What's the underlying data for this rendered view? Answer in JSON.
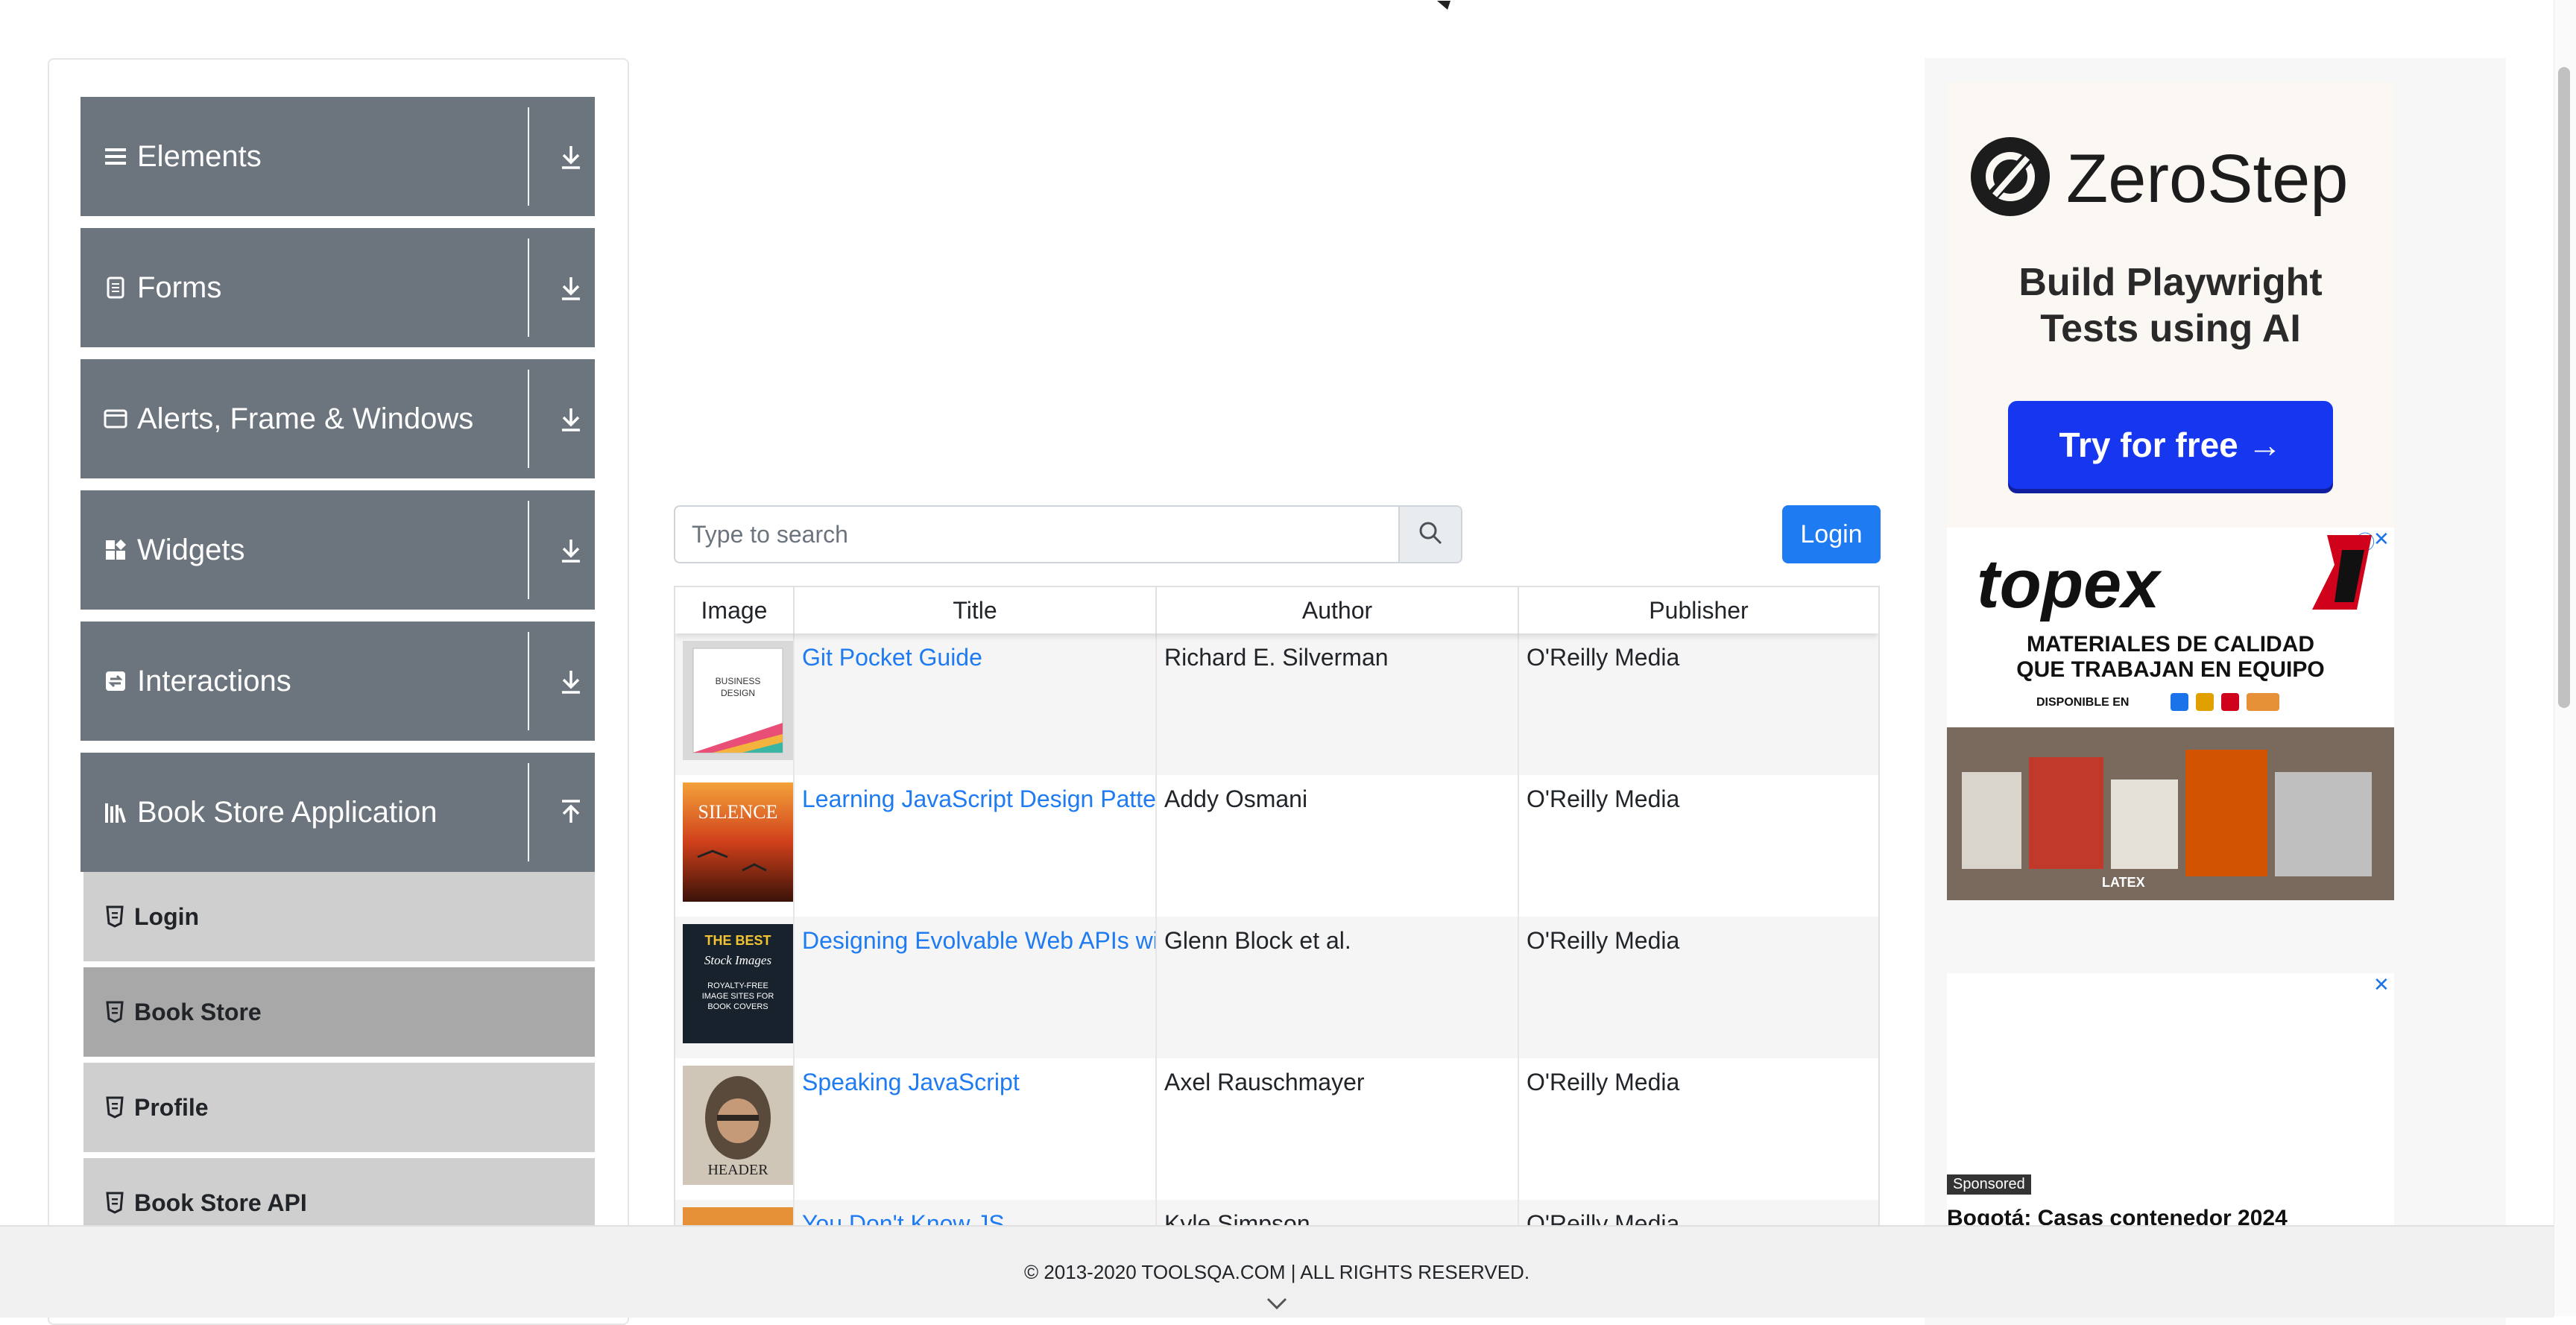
{
  "sidebar": {
    "groups": [
      {
        "label": "Elements",
        "icon": "list-icon"
      },
      {
        "label": "Forms",
        "icon": "document-icon"
      },
      {
        "label": "Alerts, Frame & Windows",
        "icon": "window-icon"
      },
      {
        "label": "Widgets",
        "icon": "widgets-icon"
      },
      {
        "label": "Interactions",
        "icon": "interactions-icon"
      },
      {
        "label": "Book Store Application",
        "icon": "books-icon"
      }
    ],
    "book_store_items": [
      {
        "label": "Login"
      },
      {
        "label": "Book Store"
      },
      {
        "label": "Profile"
      },
      {
        "label": "Book Store API"
      }
    ]
  },
  "search": {
    "placeholder": "Type to search"
  },
  "login_button": "Login",
  "table": {
    "headers": [
      "Image",
      "Title",
      "Author",
      "Publisher"
    ],
    "rows": [
      {
        "title": "Git Pocket Guide",
        "author": "Richard E. Silverman",
        "publisher": "O'Reilly Media",
        "cover_text": [
          "BUSINESS",
          "DESIGN"
        ]
      },
      {
        "title": "Learning JavaScript Design Patte",
        "author": "Addy Osmani",
        "publisher": "O'Reilly Media",
        "cover_text": [
          "SILENCE"
        ]
      },
      {
        "title": "Designing Evolvable Web APIs wi",
        "author": "Glenn Block et al.",
        "publisher": "O'Reilly Media",
        "cover_text": [
          "THE BEST",
          "Stock Images",
          "ROYALTY-FREE",
          "IMAGE SITES FOR",
          "BOOK COVERS"
        ]
      },
      {
        "title": "Speaking JavaScript",
        "author": "Axel Rauschmayer",
        "publisher": "O'Reilly Media",
        "cover_text": [
          "HEADER"
        ]
      },
      {
        "title": "You Don't Know JS",
        "author": "Kyle Simpson",
        "publisher": "O'Reilly Media",
        "cover_text": []
      }
    ]
  },
  "ads": {
    "zerostep": {
      "brand": "ZeroStep",
      "tagline": "Build Playwright Tests using AI",
      "cta": "Try for free →"
    },
    "topex": {
      "brand": "topex",
      "line1": "MATERIALES DE CALIDAD",
      "line2": "QUE TRABAJAN EN EQUIPO",
      "small": "DISPONIBLE EN",
      "product_label": "LATEX"
    },
    "sponsored": {
      "badge": "Sponsored",
      "headline": "Bogotá: Casas contenedor 2024"
    },
    "close_symbol": "✕",
    "info_symbol": "ⓘ"
  },
  "footer": {
    "copyright": "© 2013-2020 TOOLSQA.COM | ALL RIGHTS RESERVED."
  },
  "colors": {
    "accent": "#1e7bf2",
    "sidebar_header": "#6c757d",
    "sub_item": "#cfcfcf",
    "sub_item_active": "#a8a8a8",
    "zerostep_cta": "#1736f0"
  }
}
